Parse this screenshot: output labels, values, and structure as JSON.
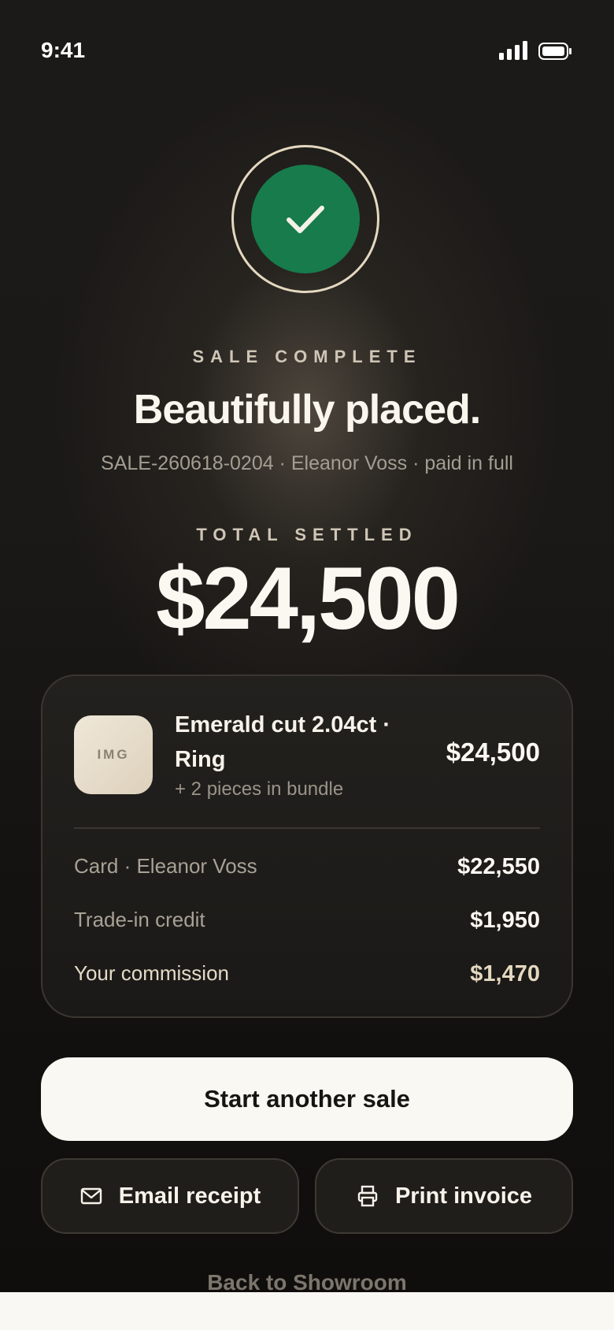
{
  "status_bar": {
    "time": "9:41",
    "signal_icon": "cellular-signal-icon",
    "battery_icon": "battery-full-icon"
  },
  "hero": {
    "badge_icon": "checkmark-icon",
    "eyebrow": "SALE COMPLETE",
    "headline": "Beautifully placed.",
    "subline": "SALE-260618-0204 · Eleanor Voss · paid in full"
  },
  "total": {
    "label": "TOTAL SETTLED",
    "amount": "$24,500"
  },
  "summary_card": {
    "item": {
      "thumbnail_text": "IMG",
      "name": "Emerald cut 2.04ct · Ring",
      "bundle_note": "+ 2 pieces in bundle",
      "price": "$24,500"
    },
    "rows": [
      {
        "label": "Card · Eleanor Voss",
        "value": "$22,550"
      },
      {
        "label": "Trade-in credit",
        "value": "$1,950"
      },
      {
        "label": "Your commission",
        "value": "$1,470"
      }
    ]
  },
  "actions": {
    "primary": "Start another sale",
    "email": {
      "label": "Email receipt",
      "icon": "envelope-icon"
    },
    "print": {
      "label": "Print invoice",
      "icon": "printer-icon"
    },
    "back": "Back to Showroom"
  },
  "colors": {
    "success": "#177b4c",
    "ring": "#e4d8c0",
    "background": "#1b1917",
    "primary_button": "#faf8f2"
  }
}
